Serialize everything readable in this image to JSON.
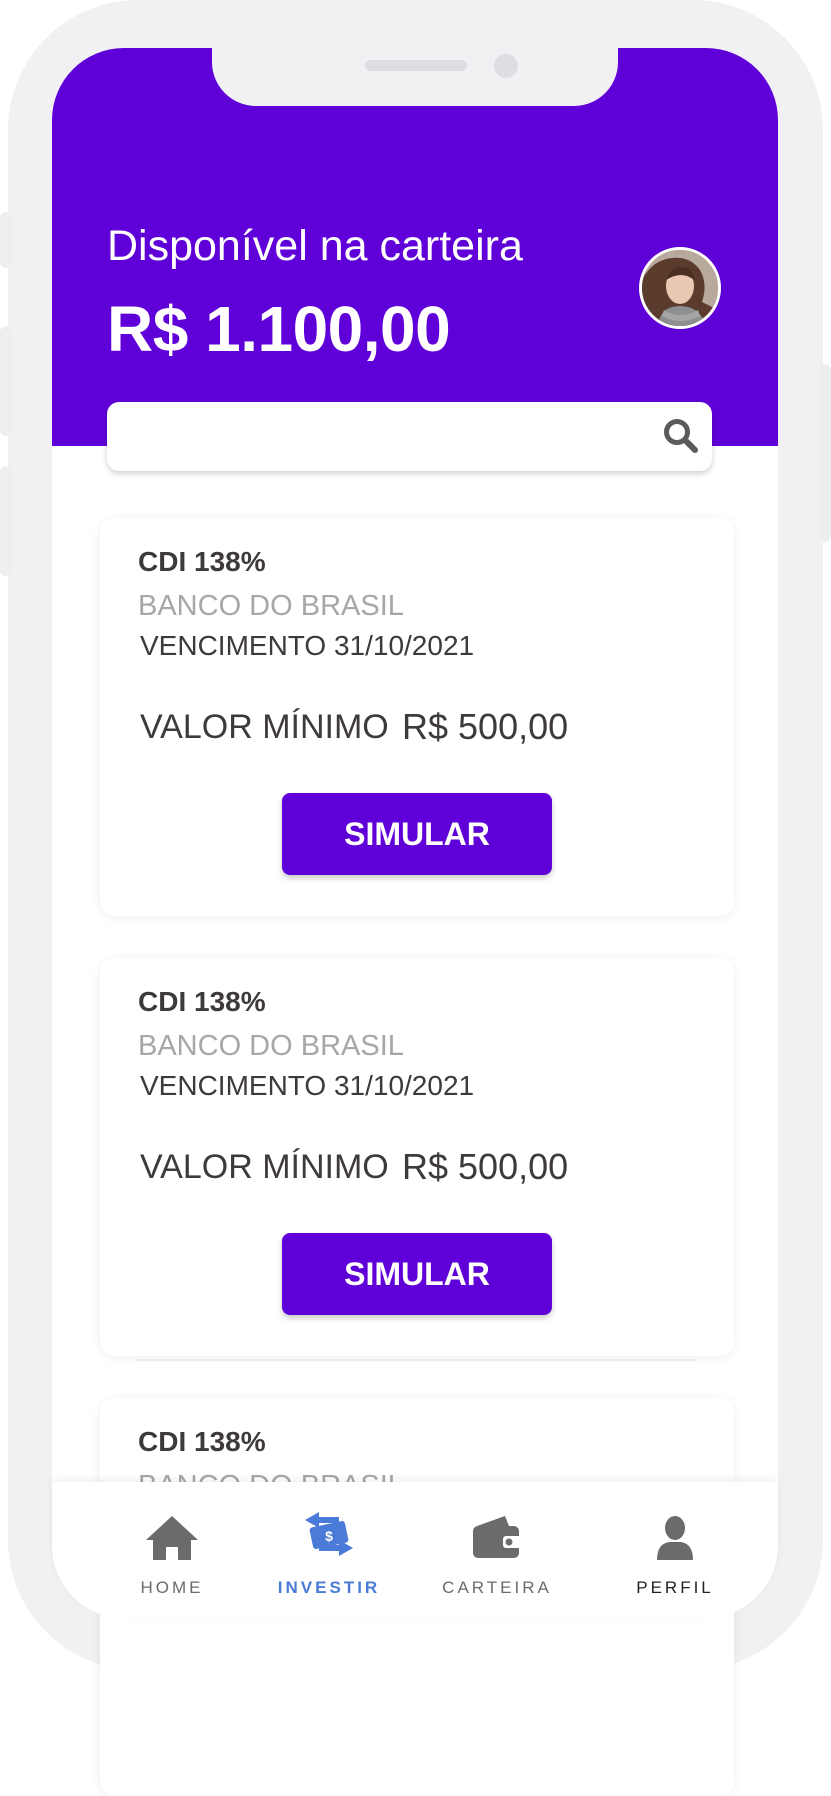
{
  "header": {
    "label": "Disponível na carteira",
    "amount": "R$ 1.100,00"
  },
  "search": {
    "value": "",
    "placeholder": ""
  },
  "cards": [
    {
      "rate": "CDI 138%",
      "bank": "BANCO DO BRASIL",
      "due": "VENCIMENTO 31/10/2021",
      "min_label": "VALOR MÍNIMO",
      "min_value": "R$ 500,00",
      "button": "SIMULAR"
    },
    {
      "rate": "CDI 138%",
      "bank": "BANCO DO BRASIL",
      "due": "VENCIMENTO 31/10/2021",
      "min_label": "VALOR MÍNIMO",
      "min_value": "R$ 500,00",
      "button": "SIMULAR"
    },
    {
      "rate": "CDI 138%",
      "bank": "BANCO DO BRASIL"
    }
  ],
  "nav": {
    "active": "investir",
    "items": [
      {
        "label": "HOME",
        "icon": "home-icon",
        "color": "#6b6b6b"
      },
      {
        "label": "INVESTIR",
        "icon": "investir-icon",
        "color": "#4a7bd8"
      },
      {
        "label": "CARTEIRA",
        "icon": "wallet-icon",
        "color": "#6b6b6b"
      },
      {
        "label": "PERFIL",
        "icon": "profile-icon",
        "color": "#222222"
      }
    ]
  },
  "colors": {
    "primary": "#5f00d9",
    "nav_active": "#4a7bd8",
    "text_dark": "#3f3a3a",
    "text_muted": "#a9a6a8"
  }
}
